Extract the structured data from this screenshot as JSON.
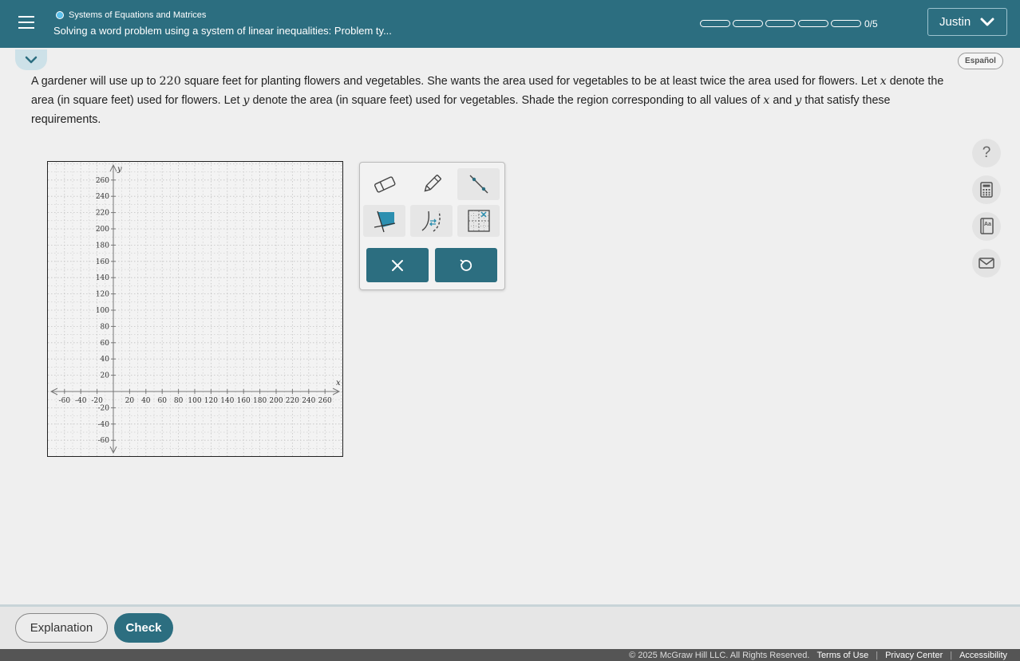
{
  "header": {
    "breadcrumb": "Systems of Equations and Matrices",
    "title": "Solving a word problem using a system of linear inequalities: Problem ty...",
    "progress": {
      "completed": 0,
      "total": 5,
      "label": "0/5"
    },
    "user_name": "Justin"
  },
  "language_button": "Español",
  "problem": {
    "p1": "A gardener will use up to ",
    "v1": "220",
    "p2": " square feet for planting flowers and vegetables. She wants the area used for vegetables to be at least twice the area used for flowers. Let ",
    "v2": "x",
    "p3": " denote the area (in square feet) used for flowers. Let ",
    "v3": "y",
    "p4": " denote the area (in square feet) used for vegetables. Shade the region corresponding to all values of ",
    "v4": "x",
    "p5": " and ",
    "v5": "y",
    "p6": " that satisfy these requirements."
  },
  "graph": {
    "x_label": "x",
    "y_label": "y",
    "x_ticks": [
      "-60",
      "-40",
      "-20",
      "20",
      "40",
      "60",
      "80",
      "100",
      "120",
      "140",
      "160",
      "180",
      "200",
      "220",
      "240",
      "260"
    ],
    "y_ticks": [
      "260",
      "240",
      "220",
      "200",
      "180",
      "160",
      "140",
      "120",
      "100",
      "80",
      "60",
      "40",
      "20",
      "-20",
      "-40",
      "-60"
    ]
  },
  "side_tools": [
    {
      "icon": "help-icon",
      "label": "?"
    },
    {
      "icon": "calculator-icon",
      "label": ""
    },
    {
      "icon": "dictionary-icon",
      "label": "Aa"
    },
    {
      "icon": "mail-icon",
      "label": ""
    }
  ],
  "palette_tools": [
    "eraser-icon",
    "pencil-icon",
    "line-icon",
    "shade-region-icon",
    "toggle-boundary-icon",
    "move-grid-icon",
    "clear-icon",
    "undo-icon"
  ],
  "buttons": {
    "explanation": "Explanation",
    "check": "Check"
  },
  "footer": {
    "copyright": "© 2025 McGraw Hill LLC. All Rights Reserved.",
    "terms": "Terms of Use",
    "privacy": "Privacy Center",
    "accessibility": "Accessibility",
    "separator": "|"
  },
  "colors": {
    "header": "#2c6e80",
    "accent": "#2c6e80",
    "progress_dot": "#5bc0eb"
  }
}
